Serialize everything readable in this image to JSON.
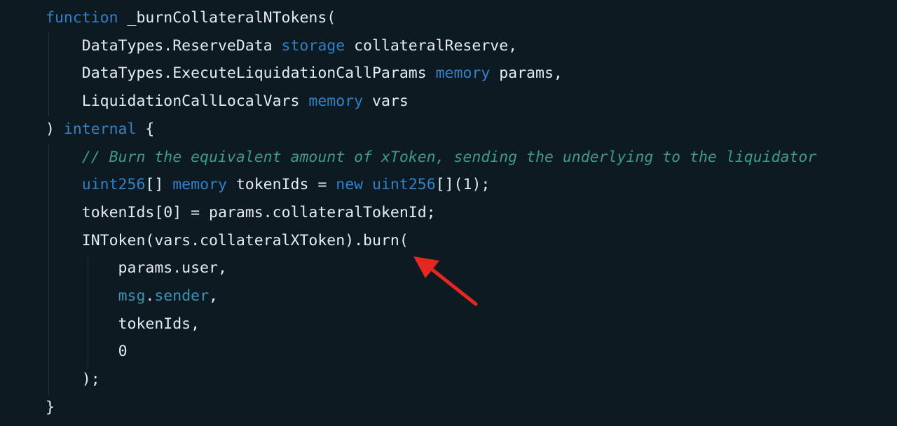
{
  "code": {
    "lines": [
      [
        {
          "t": "function",
          "c": "kw"
        },
        {
          "t": " _burnCollateralNTokens(",
          "c": "plain"
        }
      ],
      [
        {
          "t": "    DataTypes.ReserveData ",
          "c": "plain"
        },
        {
          "t": "storage",
          "c": "kw"
        },
        {
          "t": " collateralReserve,",
          "c": "plain"
        }
      ],
      [
        {
          "t": "    DataTypes.ExecuteLiquidationCallParams ",
          "c": "plain"
        },
        {
          "t": "memory",
          "c": "kw"
        },
        {
          "t": " params,",
          "c": "plain"
        }
      ],
      [
        {
          "t": "    LiquidationCallLocalVars ",
          "c": "plain"
        },
        {
          "t": "memory",
          "c": "kw"
        },
        {
          "t": " vars",
          "c": "plain"
        }
      ],
      [
        {
          "t": ") ",
          "c": "plain"
        },
        {
          "t": "internal",
          "c": "kw"
        },
        {
          "t": " {",
          "c": "plain"
        }
      ],
      [
        {
          "t": "    ",
          "c": "plain"
        },
        {
          "t": "// Burn the equivalent amount of xToken, sending the underlying to the liquidator",
          "c": "cmt"
        }
      ],
      [
        {
          "t": "    ",
          "c": "plain"
        },
        {
          "t": "uint256",
          "c": "kw"
        },
        {
          "t": "[] ",
          "c": "plain"
        },
        {
          "t": "memory",
          "c": "kw"
        },
        {
          "t": " tokenIds = ",
          "c": "plain"
        },
        {
          "t": "new",
          "c": "kw"
        },
        {
          "t": " ",
          "c": "plain"
        },
        {
          "t": "uint256",
          "c": "kw"
        },
        {
          "t": "[](",
          "c": "plain"
        },
        {
          "t": "1",
          "c": "num"
        },
        {
          "t": ");",
          "c": "plain"
        }
      ],
      [
        {
          "t": "    tokenIds[",
          "c": "plain"
        },
        {
          "t": "0",
          "c": "num"
        },
        {
          "t": "] = params.collateralTokenId;",
          "c": "plain"
        }
      ],
      [
        {
          "t": "    INToken(vars.collateralXToken).burn(",
          "c": "plain"
        }
      ],
      [
        {
          "t": "        params.user,",
          "c": "plain"
        }
      ],
      [
        {
          "t": "        ",
          "c": "plain"
        },
        {
          "t": "msg",
          "c": "glob"
        },
        {
          "t": ".",
          "c": "plain"
        },
        {
          "t": "sender",
          "c": "glob"
        },
        {
          "t": ",",
          "c": "plain"
        }
      ],
      [
        {
          "t": "        tokenIds,",
          "c": "plain"
        }
      ],
      [
        {
          "t": "        ",
          "c": "plain"
        },
        {
          "t": "0",
          "c": "num"
        }
      ],
      [
        {
          "t": "    );",
          "c": "plain"
        }
      ],
      [
        {
          "t": "}",
          "c": "plain"
        }
      ]
    ]
  },
  "annotation": {
    "arrow_color": "#e5281f"
  },
  "colors": {
    "background": "#0d1a22",
    "keyword": "#2f82c9",
    "comment": "#3d9a84",
    "text": "#e4ecef",
    "global": "#3f93b4"
  }
}
